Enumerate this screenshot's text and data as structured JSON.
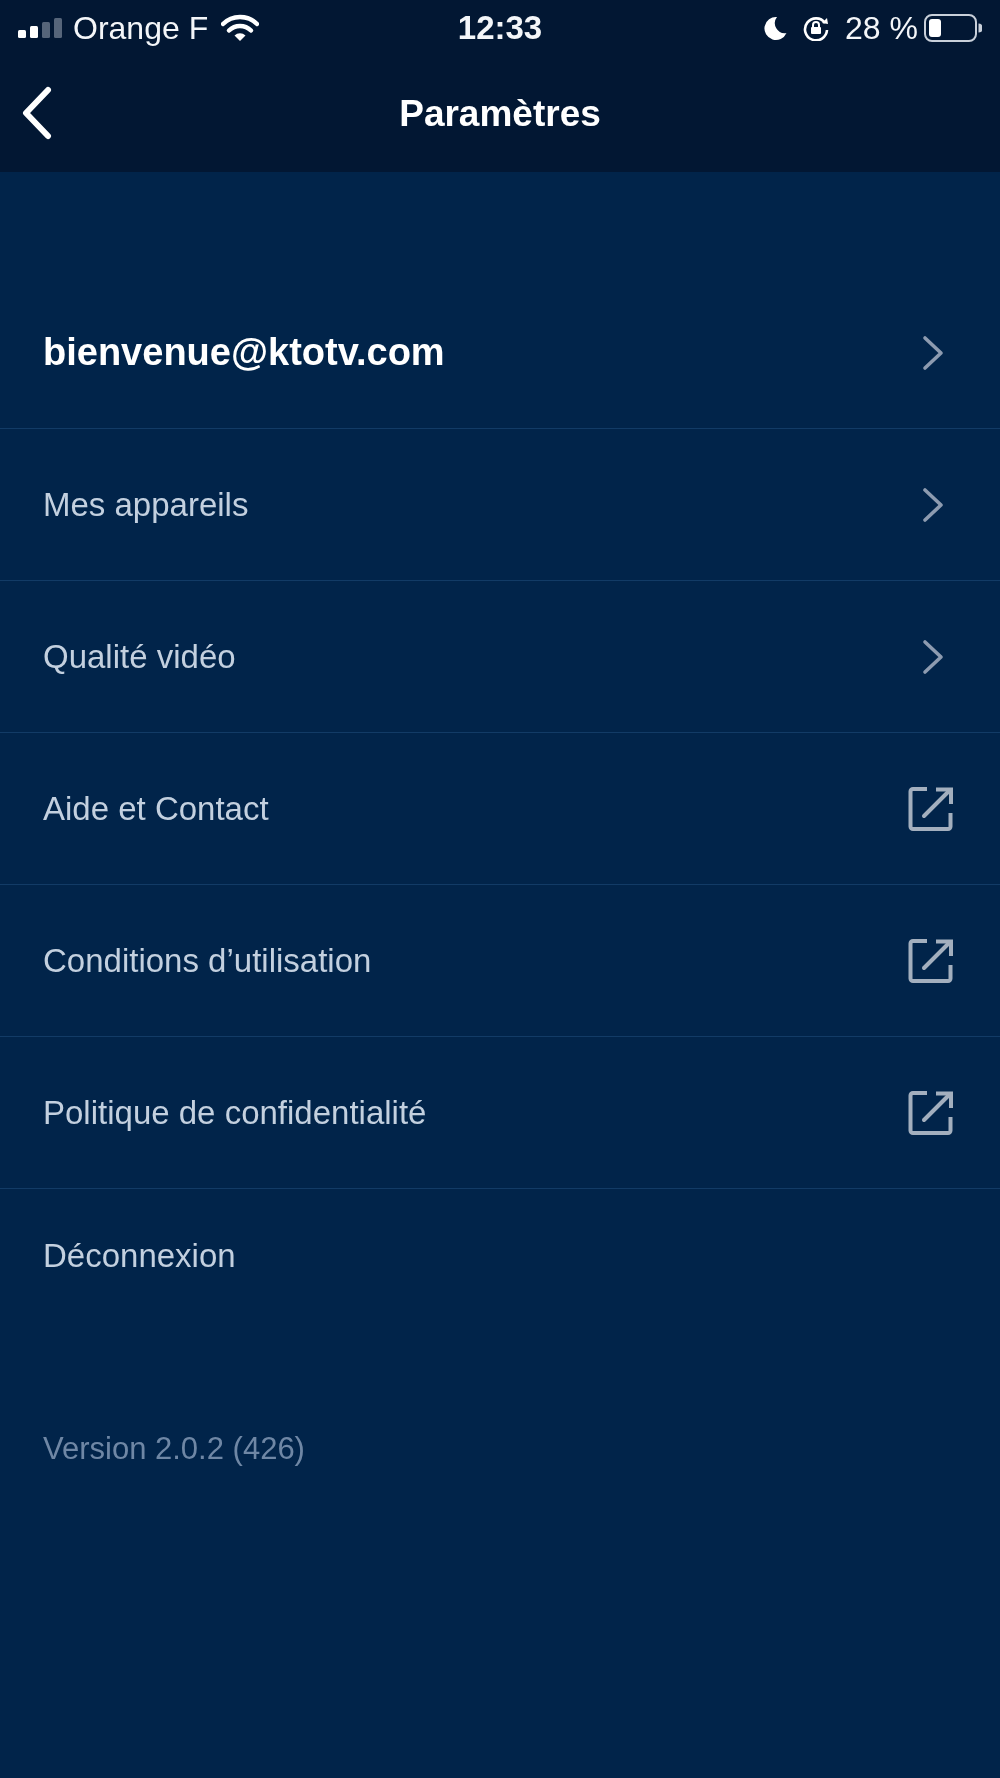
{
  "status_bar": {
    "carrier": "Orange F",
    "time": "12:33",
    "battery": "28 %"
  },
  "header": {
    "title": "Paramètres"
  },
  "items": [
    {
      "label": "bienvenue@ktotv.com",
      "kind": "account"
    },
    {
      "label": "Mes appareils",
      "kind": "chevron"
    },
    {
      "label": "Qualité vidéo",
      "kind": "chevron"
    },
    {
      "label": "Aide et Contact",
      "kind": "external"
    },
    {
      "label": "Conditions d’utilisation",
      "kind": "external"
    },
    {
      "label": "Politique de confidentialité",
      "kind": "external"
    },
    {
      "label": "Déconnexion",
      "kind": "plain"
    }
  ],
  "version": "Version 2.0.2 (426)"
}
